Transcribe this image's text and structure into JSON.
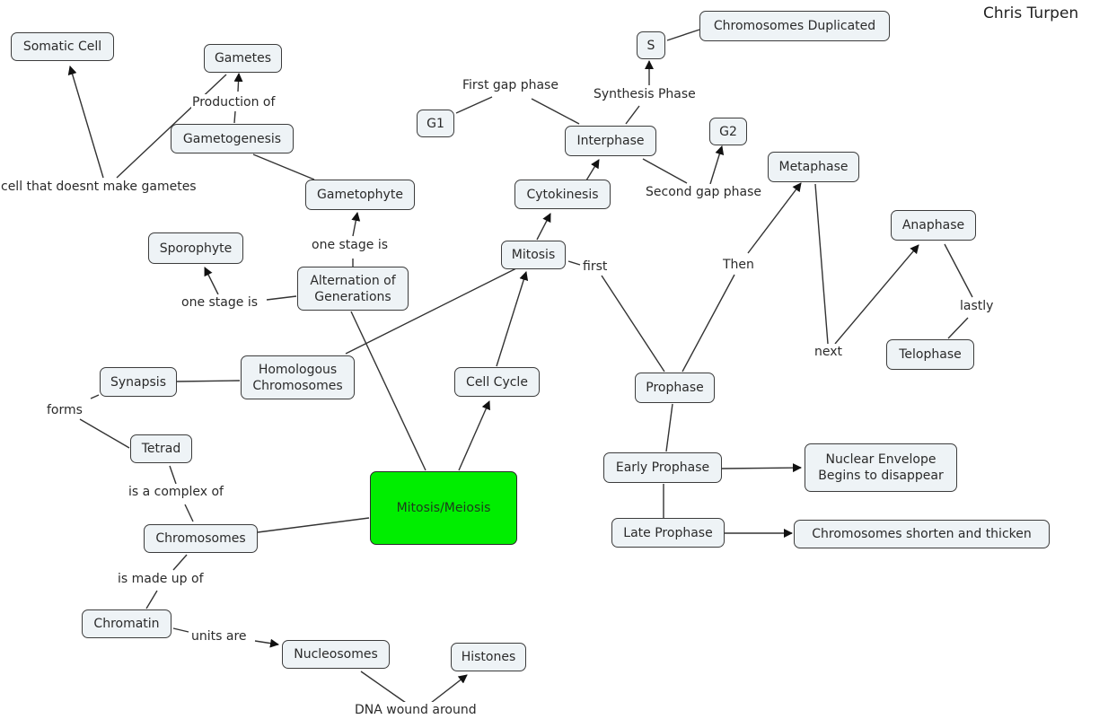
{
  "author": "Chris Turpen",
  "colors": {
    "node_fill": "#eef3f6",
    "root_fill": "#00ee00",
    "line": "#333333"
  },
  "nodes": {
    "somatic_cell": "Somatic Cell",
    "gametes": "Gametes",
    "gametogenesis": "Gametogenesis",
    "gametophyte": "Gametophyte",
    "sporophyte": "Sporophyte",
    "alternation": "Alternation of\nGenerations",
    "homologous": "Homologous\nChromosomes",
    "synapsis": "Synapsis",
    "tetrad": "Tetrad",
    "chromosomes": "Chromosomes",
    "chromatin": "Chromatin",
    "nucleosomes": "Nucleosomes",
    "histones": "Histones",
    "root": "Mitosis/Meiosis",
    "cell_cycle": "Cell Cycle",
    "mitosis": "Mitosis",
    "cytokinesis": "Cytokinesis",
    "interphase": "Interphase",
    "g1": "G1",
    "s": "S",
    "g2": "G2",
    "chromosomes_duplicated": "Chromosomes Duplicated",
    "prophase": "Prophase",
    "metaphase": "Metaphase",
    "anaphase": "Anaphase",
    "telophase": "Telophase",
    "early_prophase": "Early Prophase",
    "late_prophase": "Late Prophase",
    "nuclear_envelope": "Nuclear Envelope\nBegins to disappear",
    "shorten_thicken": "Chromosomes shorten and thicken"
  },
  "links": {
    "cell_not_gametes": "cell that doesnt make gametes",
    "production_of": "Production of",
    "one_stage_is_1": "one stage is",
    "one_stage_is_2": "one stage is",
    "forms": "forms",
    "complex_of": "is a complex of",
    "made_up_of": "is made up of",
    "units_are": "units are",
    "dna_wound": "DNA wound around",
    "first_gap": "First gap phase",
    "synthesis": "Synthesis Phase",
    "second_gap": "Second gap phase",
    "first": "first",
    "then": "Then",
    "next": "next",
    "lastly": "lastly"
  }
}
